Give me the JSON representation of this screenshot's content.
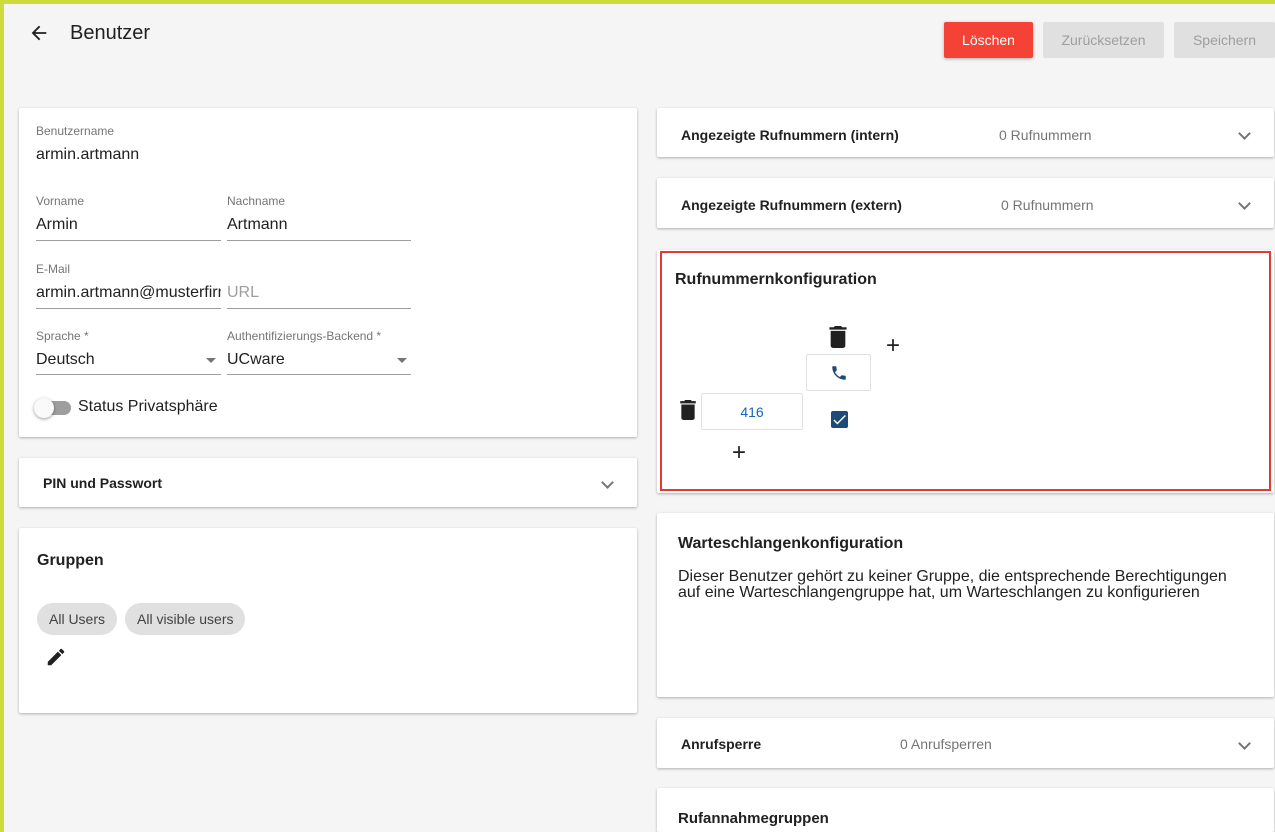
{
  "header": {
    "title": "Benutzer",
    "delete_label": "Löschen",
    "reset_label": "Zurücksetzen",
    "save_label": "Speichern"
  },
  "user_form": {
    "username_label": "Benutzername",
    "username_value": "armin.artmann",
    "firstname_label": "Vorname",
    "firstname_value": "Armin",
    "lastname_label": "Nachname",
    "lastname_value": "Artmann",
    "email_label": "E-Mail",
    "email_value": "armin.artmann@musterfirma.de",
    "url_placeholder": "URL",
    "language_label": "Sprache *",
    "language_value": "Deutsch",
    "auth_label": "Authentifizierungs-Backend *",
    "auth_value": "UCware",
    "privacy_label": "Status Privatsphäre"
  },
  "pin_section": {
    "title": "PIN und Passwort"
  },
  "groups": {
    "title": "Gruppen",
    "chips": [
      "All Users",
      "All visible users"
    ]
  },
  "internal_numbers": {
    "title": "Angezeigte Rufnummern (intern)",
    "count": "0 Rufnummern"
  },
  "external_numbers": {
    "title": "Angezeigte Rufnummern (extern)",
    "count": "0 Rufnummern"
  },
  "number_config": {
    "title": "Rufnummernkonfiguration",
    "number": "416",
    "checked": true
  },
  "queue_config": {
    "title": "Warteschlangenkonfiguration",
    "line1": "Dieser Benutzer gehört zu keiner Gruppe, die entsprechende Berechtigungen",
    "line2": "auf eine Warteschlangengruppe hat, um Warteschlangen zu konfigurieren"
  },
  "call_block": {
    "title": "Anrufsperre",
    "count": "0 Anrufsperren"
  },
  "pickup_groups": {
    "title": "Rufannahmegruppen"
  },
  "colors": {
    "accent": "#cddc39",
    "danger": "#f44336",
    "highlight": "#e53935",
    "checkbox": "#1e4a77",
    "number": "#1565c0"
  }
}
